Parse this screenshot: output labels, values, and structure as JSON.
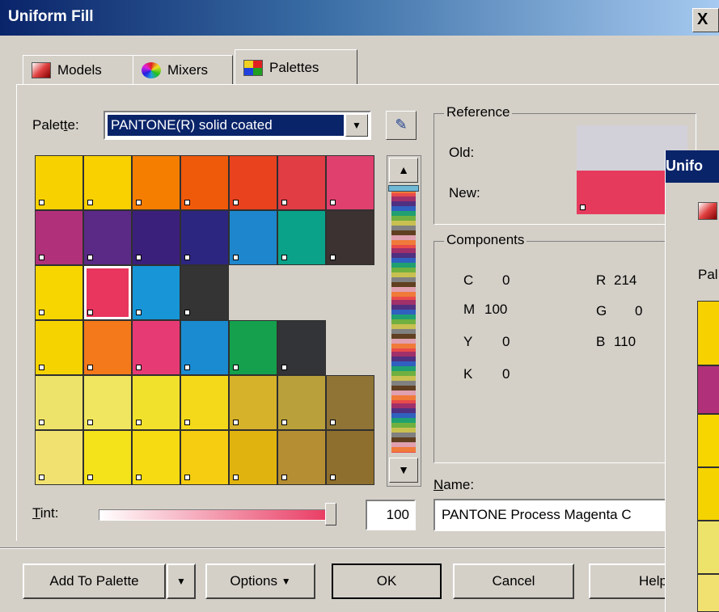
{
  "window": {
    "title": "Uniform Fill",
    "close": "X"
  },
  "tabs": [
    {
      "label": "Models"
    },
    {
      "label": "Mixers"
    },
    {
      "label": "Palettes"
    }
  ],
  "palette": {
    "label_pre": "Palet",
    "label_acc": "t",
    "label_post": "e:",
    "selected": "PANTONE(R) solid coated"
  },
  "swatches": [
    [
      "#f7d100",
      "#f9d000",
      "#f57e00",
      "#ef5a0a",
      "#e8421e",
      "#e03d45",
      "#e0406e"
    ],
    [
      "#b1307a",
      "#5a2a86",
      "#3a1f7b",
      "#2d2680",
      "#1e86cc",
      "#0aa38a",
      "#3c3232"
    ],
    [
      "#f7d600",
      "#e8365e",
      "#1795d6",
      "#343434",
      null,
      null,
      null
    ],
    [
      "#f5d300",
      "#f3791a",
      "#e63a74",
      "#1a8bd1",
      "#14a04c",
      "#333438",
      null
    ],
    [
      "#eee36a",
      "#f0e660",
      "#f1e02c",
      "#f4d91b",
      "#d6b12a",
      "#b9a03a",
      "#8f7436"
    ],
    [
      "#f1e170",
      "#f4e21a",
      "#f6db12",
      "#f6cd10",
      "#e1b30e",
      "#b58e34",
      "#8f6f2d"
    ]
  ],
  "tint": {
    "label": "Tint:",
    "acc": "T",
    "rest": "int:",
    "value": "100"
  },
  "reference": {
    "title": "Reference",
    "old_label": "Old:",
    "new_label": "New:",
    "old_color": "#d2d0d8",
    "new_color": "#e63a5d"
  },
  "components": {
    "title": "Components",
    "C": "0",
    "M": "100",
    "Y": "0",
    "K": "0",
    "R": "214",
    "G": "0",
    "B": "110"
  },
  "name": {
    "label": "Name:",
    "value": "PANTONE Process Magenta C"
  },
  "buttons": {
    "add_to_palette": "Add To Palette",
    "options": "Options",
    "ok": "OK",
    "cancel": "Cancel",
    "help": "Help"
  },
  "second_window": {
    "title": "Unifo",
    "palette_label": "Pal"
  }
}
